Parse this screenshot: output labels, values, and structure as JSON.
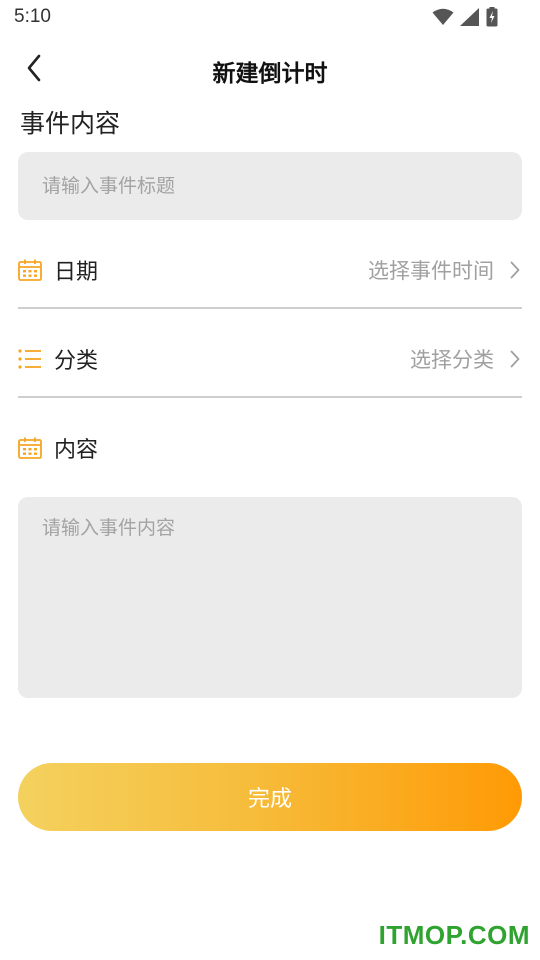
{
  "status_bar": {
    "time": "5:10",
    "icons": [
      "wifi-icon",
      "signal-icon",
      "battery-charging-icon"
    ]
  },
  "header": {
    "back_icon": "chevron-left-icon",
    "title": "新建倒计时"
  },
  "event": {
    "section_label": "事件内容",
    "title_placeholder": "请输入事件标题",
    "title_value": ""
  },
  "rows": {
    "date": {
      "icon": "calendar-icon",
      "label": "日期",
      "value": "选择事件时间"
    },
    "category": {
      "icon": "list-icon",
      "label": "分类",
      "value": "选择分类"
    },
    "content": {
      "icon": "calendar-icon",
      "label": "内容"
    }
  },
  "content": {
    "placeholder": "请输入事件内容",
    "value": ""
  },
  "actions": {
    "done_label": "完成"
  },
  "watermark": "ITMOP.COM",
  "colors": {
    "accent": "#ff9a05",
    "gradient_start": "#f4d15e",
    "gradient_end": "#ff9a05",
    "input_background": "#ebebeb",
    "watermark": "#2fa32f"
  }
}
